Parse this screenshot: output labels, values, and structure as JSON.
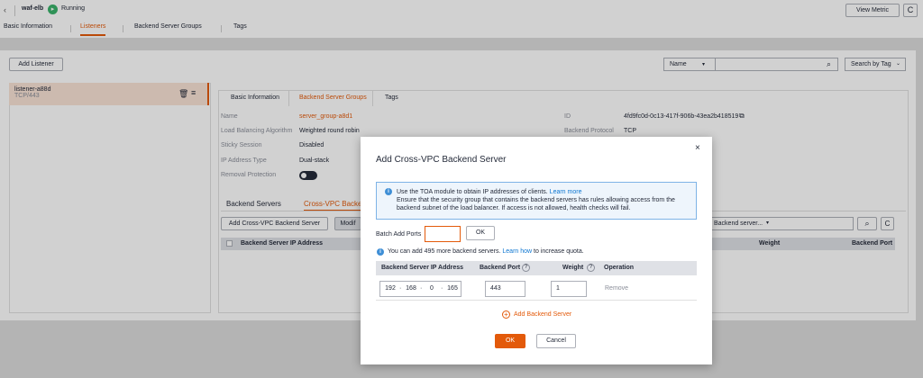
{
  "header": {
    "back_icon": "‹",
    "title": "waf-elb",
    "status": "Running",
    "view_metric": "View Metric",
    "refresh_icon": "C"
  },
  "tabs": [
    "Basic Information",
    "Listeners",
    "Backend Server Groups",
    "Tags"
  ],
  "add_listener": "Add Listener",
  "search": {
    "field": "Name",
    "search_by_tag": "Search by Tag"
  },
  "listener": {
    "name": "listener-a88d",
    "sub": "TCP/443"
  },
  "detail_tabs": [
    "Basic Information",
    "Backend Server Groups",
    "Tags"
  ],
  "details": {
    "name_label": "Name",
    "name_value": "server_group-a8d1",
    "algo_label": "Load Balancing Algorithm",
    "algo_value": "Weighted round robin",
    "sticky_label": "Sticky Session",
    "sticky_value": "Disabled",
    "ipver_label": "IP Address Type",
    "ipver_value": "Dual-stack",
    "removal_label": "Removal Protection",
    "id_label": "ID",
    "id_value": "4fd9fc0d-0c13-417f-906b-43ea2b418519",
    "proto_label": "Backend Protocol",
    "proto_value": "TCP"
  },
  "backend_tabs": [
    "Backend Servers",
    "Cross-VPC Backe"
  ],
  "actions": {
    "add_cross": "Add Cross-VPC Backend Server",
    "modify": "Modif",
    "filter": "Backend server..."
  },
  "bg_table": {
    "col_ip": "Backend Server IP Address",
    "col_weight": "Weight",
    "col_port": "Backend Port"
  },
  "modal": {
    "title": "Add Cross-VPC Backend Server",
    "info_line1": "Use the TOA module to obtain IP addresses of clients.",
    "learn_more": "Learn more",
    "info_line2": "Ensure that the security group that contains the backend servers has rules allowing access from the",
    "info_line3": "backend subnet of the load balancer. If access is not allowed, health checks will fail.",
    "batch_label": "Batch Add Ports",
    "ok_small": "OK",
    "quota_text": "You can add 495 more backend servers.",
    "learn_how": "Learn how",
    "quota_suffix": "to increase quota.",
    "col_ip": "Backend Server IP Address",
    "col_port": "Backend Port",
    "col_weight": "Weight",
    "col_operation": "Operation",
    "ip": [
      "192",
      "168",
      "0",
      "165"
    ],
    "port": "443",
    "weight": "1",
    "remove": "Remove",
    "add_server": "Add Backend Server",
    "ok": "OK",
    "cancel": "Cancel"
  },
  "colors": {
    "accent": "#e35a0a",
    "running": "#3ab36b",
    "link": "#0d76d1"
  }
}
